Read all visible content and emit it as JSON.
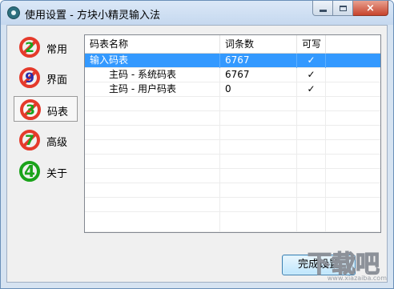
{
  "window": {
    "title": "使用设置 - 方块小精灵输入法",
    "close_label": "×"
  },
  "sidebar": {
    "items": [
      {
        "label": "常用",
        "icon": "badge-2-icon",
        "color": "#e53a2b",
        "active": false
      },
      {
        "label": "界面",
        "icon": "badge-9-icon",
        "color": "#e53a2b",
        "active": false
      },
      {
        "label": "码表",
        "icon": "badge-3-icon",
        "color": "#e53a2b",
        "active": true
      },
      {
        "label": "高级",
        "icon": "badge-7-icon",
        "color": "#e53a2b",
        "active": false
      },
      {
        "label": "关于",
        "icon": "badge-4-icon",
        "color": "#1aa31a",
        "active": false
      }
    ]
  },
  "table": {
    "columns": [
      "码表名称",
      "词条数",
      "可写"
    ],
    "rows": [
      {
        "name": "输入码表",
        "count": "6767",
        "writable": "✓",
        "selected": true
      },
      {
        "name": "主码 - 系统码表",
        "count": "6767",
        "writable": "✓",
        "selected": false
      },
      {
        "name": "主码 - 用户码表",
        "count": "0",
        "writable": "✓",
        "selected": false
      }
    ]
  },
  "footer": {
    "done_label": "完成设置"
  },
  "watermark": {
    "text": "www.xiazaiba.com",
    "logo": "下载吧"
  }
}
